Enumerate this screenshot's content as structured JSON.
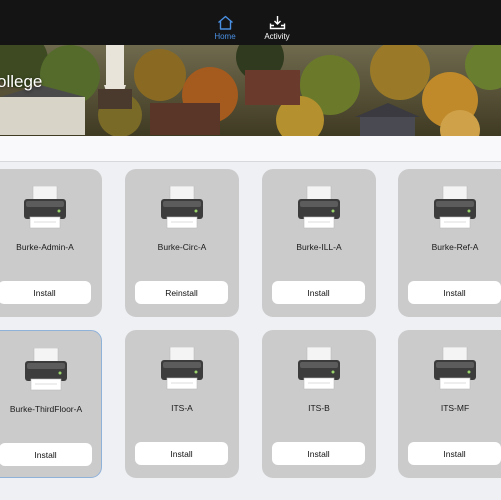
{
  "nav": {
    "home_label": "Home",
    "activity_label": "Activity"
  },
  "hero": {
    "title": "ollege"
  },
  "printers": [
    {
      "name": "Burke-Admin-A",
      "action": "Install"
    },
    {
      "name": "Burke-Circ-A",
      "action": "Reinstall"
    },
    {
      "name": "Burke-ILL-A",
      "action": "Install"
    },
    {
      "name": "Burke-Ref-A",
      "action": "Install"
    },
    {
      "name": "Burke-ThirdFloor-A",
      "action": "Install"
    },
    {
      "name": "ITS-A",
      "action": "Install"
    },
    {
      "name": "ITS-B",
      "action": "Install"
    },
    {
      "name": "ITS-MF",
      "action": "Install"
    }
  ],
  "colors": {
    "accent": "#4a90e2",
    "topbar": "#141414",
    "card": "#cbcbcb"
  },
  "icons": {
    "home": "home-icon",
    "activity": "tray-download-icon",
    "printer": "printer-icon"
  }
}
